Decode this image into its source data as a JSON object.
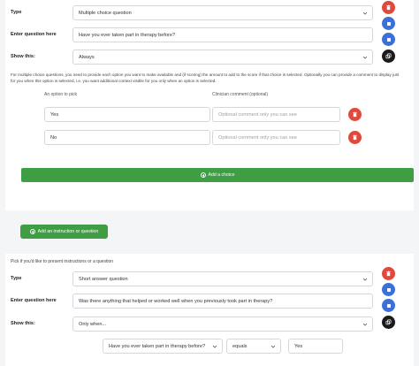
{
  "question1": {
    "type_label": "Type",
    "type_value": "Multiple choice question",
    "question_label": "Enter question here",
    "question_value": "Have you ever taken part in therapy before?",
    "show_label": "Show this:",
    "show_value": "Always",
    "help_text": "For multiple choice questions, you need to provide each option you want to make available and (if scoring) the amount to add to the score if that choice is selected. Optionally you can provide a comment to display just for you when this option is selected, i.e. you want additional context visible for you only when an option is selected.",
    "col_option": "An option to pick",
    "col_comment": "Clinician comment (optional)",
    "options": [
      {
        "value": "Yes",
        "comment_placeholder": "Optional comment only you can see"
      },
      {
        "value": "No",
        "comment_placeholder": "Optional comment only you can see"
      }
    ],
    "add_choice_label": "Add a choice"
  },
  "add_instruction_label": "Add an instruction or question",
  "pick_note": "Pick if you'd like to present instructions or a question",
  "question2": {
    "type_label": "Type",
    "type_value": "Short answer question",
    "question_label": "Enter question here",
    "question_value": "Was there anything that helped or worked well when you previously took part in therapy?",
    "show_label": "Show this:",
    "show_value": "Only when...",
    "condition_question": "Have you ever taken part in therapy before?",
    "condition_operator": "equals",
    "condition_value": "Yes"
  },
  "icons": {
    "delete": "trash-icon",
    "move_up": "arrow-up-icon",
    "move_down": "arrow-down-icon",
    "duplicate": "copy-icon"
  },
  "colors": {
    "green": "#3f9d43",
    "red": "#e04a3c",
    "blue": "#3d6fd8",
    "dark": "#1b1b1b"
  }
}
